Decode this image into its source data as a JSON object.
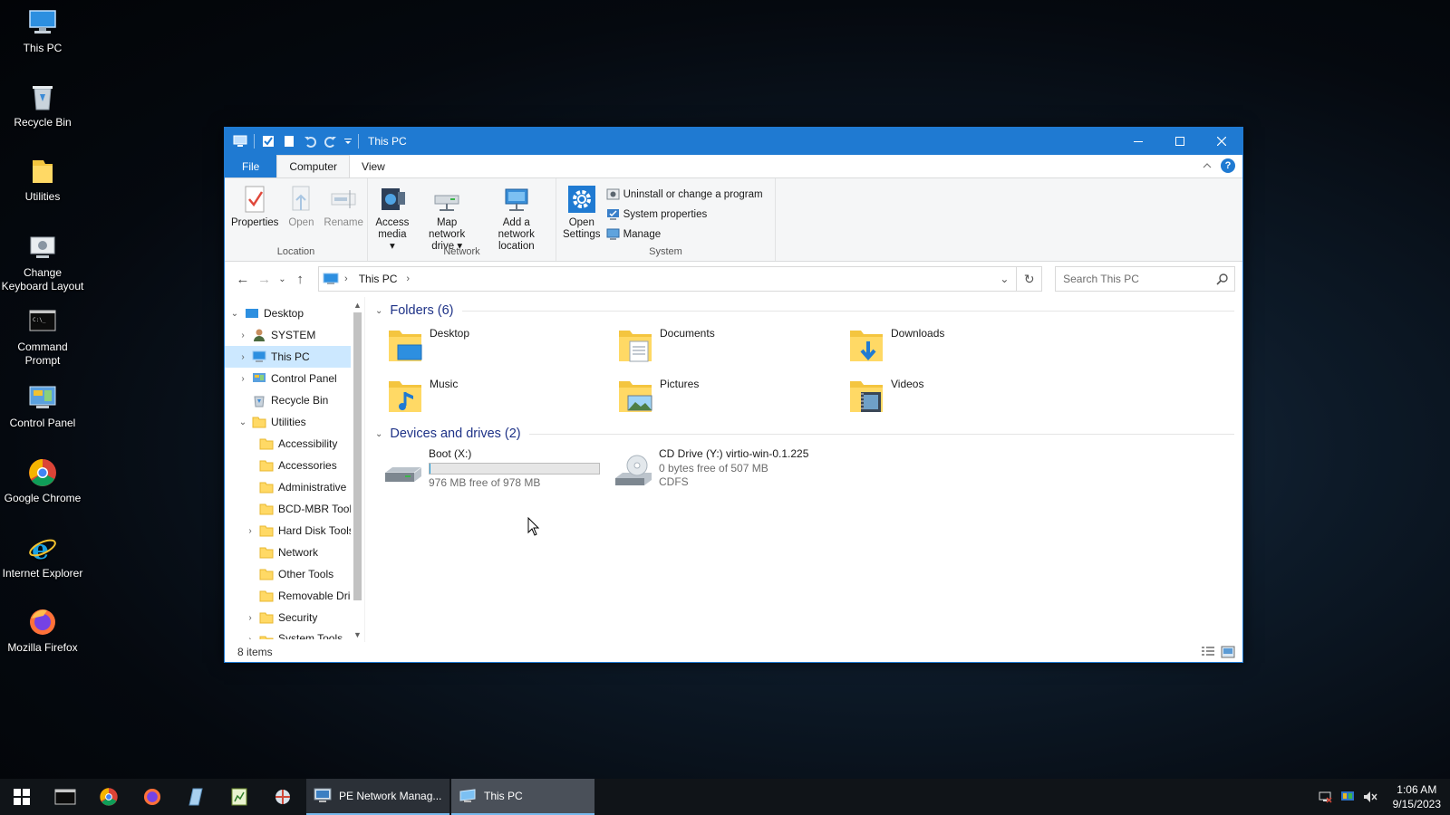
{
  "desktop": {
    "icons": [
      {
        "label": "This PC",
        "icon": "computer-icon"
      },
      {
        "label": "Recycle Bin",
        "icon": "recycle-bin-icon"
      },
      {
        "label": "Utilities",
        "icon": "folder-icon"
      },
      {
        "label": "Change Keyboard Layout",
        "icon": "keyboard-icon"
      },
      {
        "label": "Command Prompt",
        "icon": "cmd-icon"
      },
      {
        "label": "Control Panel",
        "icon": "control-panel-icon"
      },
      {
        "label": "Google Chrome",
        "icon": "chrome-icon"
      },
      {
        "label": "Internet Explorer",
        "icon": "ie-icon"
      },
      {
        "label": "Mozilla Firefox",
        "icon": "firefox-icon"
      }
    ]
  },
  "window": {
    "title": "This PC",
    "tabs": {
      "file": "File",
      "computer": "Computer",
      "view": "View"
    },
    "ribbon": {
      "location": {
        "label": "Location",
        "properties": "Properties",
        "open": "Open",
        "rename": "Rename"
      },
      "network": {
        "label": "Network",
        "access_media_1": "Access",
        "access_media_2": "media",
        "map_drive_1": "Map network",
        "map_drive_2": "drive",
        "add_location_1": "Add a network",
        "add_location_2": "location"
      },
      "system": {
        "label": "System",
        "open_settings_1": "Open",
        "open_settings_2": "Settings",
        "uninstall": "Uninstall or change a program",
        "system_properties": "System properties",
        "manage": "Manage"
      }
    },
    "address": {
      "crumb": "This PC"
    },
    "search": {
      "placeholder": "Search This PC"
    },
    "tree": [
      {
        "label": "Desktop"
      },
      {
        "label": "SYSTEM"
      },
      {
        "label": "This PC"
      },
      {
        "label": "Control Panel"
      },
      {
        "label": "Recycle Bin"
      },
      {
        "label": "Utilities"
      },
      {
        "label": "Accessibility"
      },
      {
        "label": "Accessories"
      },
      {
        "label": "Administrative"
      },
      {
        "label": "BCD-MBR Tool"
      },
      {
        "label": "Hard Disk Tools"
      },
      {
        "label": "Network"
      },
      {
        "label": "Other Tools"
      },
      {
        "label": "Removable Dri"
      },
      {
        "label": "Security"
      },
      {
        "label": "System Tools"
      }
    ],
    "folders": {
      "header": "Folders (6)",
      "items": [
        "Desktop",
        "Documents",
        "Downloads",
        "Music",
        "Pictures",
        "Videos"
      ]
    },
    "devices": {
      "header": "Devices and drives (2)",
      "boot": {
        "name": "Boot (X:)",
        "free": "976 MB free of 978 MB",
        "used_fraction": 0.002
      },
      "cd": {
        "name": "CD Drive (Y:) virtio-win-0.1.225",
        "free": "0 bytes free of 507 MB",
        "fs": "CDFS"
      }
    },
    "status": {
      "items": "8 items"
    }
  },
  "taskbar": {
    "apps": [
      {
        "label": "PE Network Manag..."
      },
      {
        "label": "This PC"
      }
    ],
    "clock": {
      "time": "1:06 AM",
      "date": "9/15/2023"
    }
  },
  "colors": {
    "accent": "#1f7ad2",
    "selection": "#cce8ff",
    "group_header": "#1e3287"
  }
}
